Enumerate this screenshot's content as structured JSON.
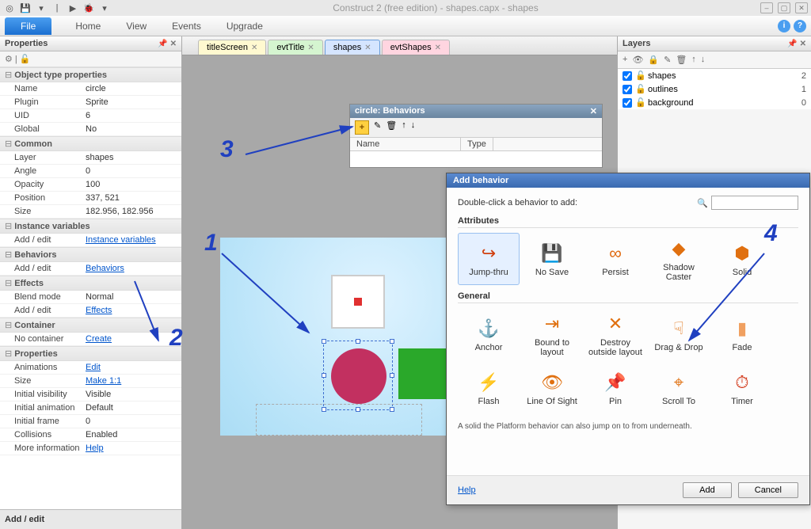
{
  "title": "Construct 2 (free edition) - shapes.capx - shapes",
  "ribbon": {
    "file": "File",
    "tabs": [
      "Home",
      "View",
      "Events",
      "Upgrade"
    ]
  },
  "panels": {
    "properties": "Properties",
    "layers": "Layers"
  },
  "props": {
    "sections": {
      "objtype": "Object type properties",
      "common": "Common",
      "instvars": "Instance variables",
      "behaviors": "Behaviors",
      "effects": "Effects",
      "container": "Container",
      "properties": "Properties"
    },
    "name_k": "Name",
    "name_v": "circle",
    "plugin_k": "Plugin",
    "plugin_v": "Sprite",
    "uid_k": "UID",
    "uid_v": "6",
    "global_k": "Global",
    "global_v": "No",
    "layer_k": "Layer",
    "layer_v": "shapes",
    "angle_k": "Angle",
    "angle_v": "0",
    "opacity_k": "Opacity",
    "opacity_v": "100",
    "position_k": "Position",
    "position_v": "337, 521",
    "size_k": "Size",
    "size_v": "182.956, 182.956",
    "addedit": "Add / edit",
    "instvars_link": "Instance variables",
    "behaviors_link": "Behaviors",
    "blend_k": "Blend mode",
    "blend_v": "Normal",
    "effects_link": "Effects",
    "nocontainer": "No container",
    "create_link": "Create",
    "anim_k": "Animations",
    "edit_link": "Edit",
    "psize_k": "Size",
    "make11": "Make 1:1",
    "initvis_k": "Initial visibility",
    "initvis_v": "Visible",
    "initanim_k": "Initial animation",
    "initanim_v": "Default",
    "initframe_k": "Initial frame",
    "initframe_v": "0",
    "coll_k": "Collisions",
    "coll_v": "Enabled",
    "moreinfo_k": "More information",
    "help_link": "Help",
    "footer": "Add / edit"
  },
  "doctabs": [
    {
      "label": "titleScreen",
      "cls": "yellow"
    },
    {
      "label": "evtTitle",
      "cls": "green"
    },
    {
      "label": "shapes",
      "cls": "blue"
    },
    {
      "label": "evtShapes",
      "cls": "pink"
    }
  ],
  "layers": [
    {
      "name": "shapes",
      "num": "2"
    },
    {
      "name": "outlines",
      "num": "1"
    },
    {
      "name": "background",
      "num": "0"
    }
  ],
  "behdlg": {
    "title": "circle: Behaviors",
    "col_name": "Name",
    "col_type": "Type"
  },
  "addb": {
    "title": "Add behavior",
    "hint": "Double-click a behavior to add:",
    "sec_attr": "Attributes",
    "sec_gen": "General",
    "items_attr": [
      {
        "label": "Jump-thru",
        "icon": "↪",
        "color": "#d04010",
        "sel": true
      },
      {
        "label": "No Save",
        "icon": "💾",
        "color": "#555"
      },
      {
        "label": "Persist",
        "icon": "∞",
        "color": "#e06a10"
      },
      {
        "label": "Shadow Caster",
        "icon": "◆",
        "color": "#e07010"
      },
      {
        "label": "Solid",
        "icon": "⬢",
        "color": "#e07010"
      }
    ],
    "items_gen": [
      {
        "label": "Anchor",
        "icon": "⚓",
        "color": "#e07010"
      },
      {
        "label": "Bound to layout",
        "icon": "⇥",
        "color": "#e07010"
      },
      {
        "label": "Destroy outside layout",
        "icon": "✕",
        "color": "#e07010"
      },
      {
        "label": "Drag & Drop",
        "icon": "☟",
        "color": "#e07010"
      },
      {
        "label": "Fade",
        "icon": "▮",
        "color": "#f0a060"
      },
      {
        "label": "Flash",
        "icon": "⚡",
        "color": "#f0a010"
      },
      {
        "label": "Line Of Sight",
        "icon": "👁",
        "color": "#e07010"
      },
      {
        "label": "Pin",
        "icon": "📌",
        "color": "#e07010"
      },
      {
        "label": "Scroll To",
        "icon": "⌖",
        "color": "#e07010"
      },
      {
        "label": "Timer",
        "icon": "⏱",
        "color": "#d03010"
      }
    ],
    "desc": "A solid the Platform behavior can also jump on to from underneath.",
    "help": "Help",
    "add": "Add",
    "cancel": "Cancel"
  },
  "anno": {
    "n1": "1",
    "n2": "2",
    "n3": "3",
    "n4": "4"
  }
}
